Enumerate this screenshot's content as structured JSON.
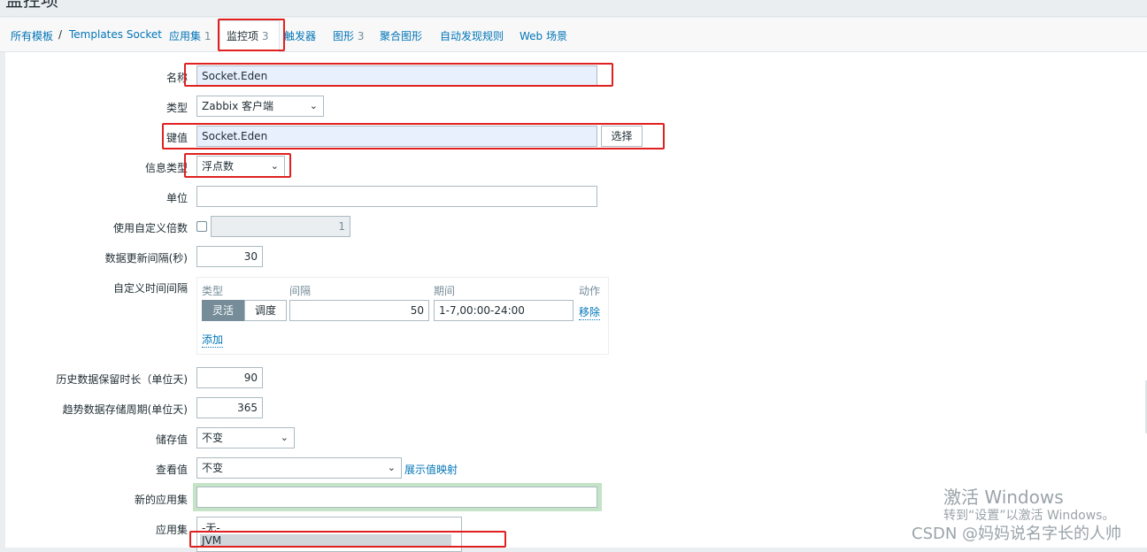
{
  "page_title": "监控项",
  "nav": {
    "all_templates": "所有模板",
    "separator": "/",
    "template_name": "Templates Socket",
    "applications": "应用集",
    "applications_count": "1",
    "items": "监控项",
    "items_count": "3",
    "triggers": "触发器",
    "graphs": "图形",
    "graphs_count": "3",
    "screens": "聚合图形",
    "discovery": "自动发现规则",
    "web": "Web 场景"
  },
  "form": {
    "name_label": "名称",
    "name_value": "Socket.Eden",
    "type_label": "类型",
    "type_value": "Zabbix 客户端",
    "key_label": "键值",
    "key_value": "Socket.Eden",
    "select_button": "选择",
    "info_type_label": "信息类型",
    "info_type_value": "浮点数",
    "units_label": "单位",
    "units_value": "",
    "multiplier_label": "使用自定义倍数",
    "multiplier_value": "1",
    "update_interval_label": "数据更新间隔(秒)",
    "update_interval_value": "30",
    "custom_intervals_label": "自定义时间间隔",
    "custom_intervals": {
      "col_type": "类型",
      "col_interval": "间隔",
      "col_period": "期间",
      "col_action": "动作",
      "flexible": "灵活",
      "scheduling": "调度",
      "interval_value": "50",
      "period_value": "1-7,00:00-24:00",
      "remove": "移除",
      "add": "添加"
    },
    "history_label": "历史数据保留时长（单位天)",
    "history_value": "90",
    "trends_label": "趋势数据存储周期(单位天)",
    "trends_value": "365",
    "store_value_label": "储存值",
    "store_value": "不变",
    "show_value_label": "查看值",
    "show_value": "不变",
    "value_mapping_link": "展示值映射",
    "new_application_label": "新的应用集",
    "new_application_value": "",
    "applications_label": "应用集",
    "applications_options": [
      "-无-",
      "JVM"
    ]
  },
  "watermark": {
    "line1": "激活 Windows",
    "line2": "转到“设置”以激活 Windows。",
    "csdn": "CSDN @妈妈说名字长的人帅"
  },
  "colors": {
    "link": "#0275b8",
    "highlight_box": "#e02020",
    "autofill_bg": "#e8f0fe",
    "active_segment": "#768d99"
  }
}
